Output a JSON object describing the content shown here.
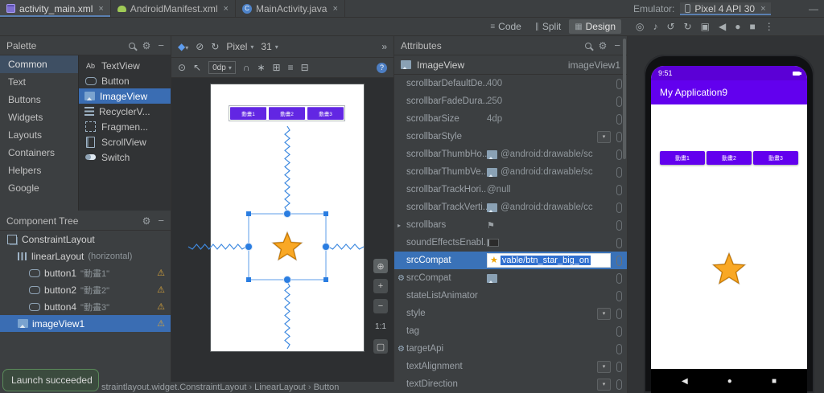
{
  "window": {
    "editor_tabs": [
      {
        "label": "activity_main.xml",
        "icon": "layout-file-icon",
        "active": true
      },
      {
        "label": "AndroidManifest.xml",
        "icon": "android-manifest-icon",
        "active": false
      },
      {
        "label": "MainActivity.java",
        "icon": "java-class-icon",
        "active": false
      }
    ],
    "view_modes": [
      {
        "label": "Code",
        "icon": "code-mode-icon",
        "active": false
      },
      {
        "label": "Split",
        "icon": "split-mode-icon",
        "active": false
      },
      {
        "label": "Design",
        "icon": "design-mode-icon",
        "active": true
      }
    ]
  },
  "palette": {
    "title": "Palette",
    "categories": [
      {
        "label": "Common",
        "selected": true
      },
      {
        "label": "Text",
        "selected": false
      },
      {
        "label": "Buttons",
        "selected": false
      },
      {
        "label": "Widgets",
        "selected": false
      },
      {
        "label": "Layouts",
        "selected": false
      },
      {
        "label": "Containers",
        "selected": false
      },
      {
        "label": "Helpers",
        "selected": false
      },
      {
        "label": "Google",
        "selected": false
      }
    ],
    "components": [
      {
        "label": "TextView",
        "icon": "textview-icon",
        "selected": false
      },
      {
        "label": "Button",
        "icon": "button-icon",
        "selected": false
      },
      {
        "label": "ImageView",
        "icon": "imageview-icon",
        "selected": true
      },
      {
        "label": "RecyclerV...",
        "icon": "recyclerview-icon",
        "selected": false
      },
      {
        "label": "Fragmen...",
        "icon": "fragment-icon",
        "selected": false
      },
      {
        "label": "ScrollView",
        "icon": "scrollview-icon",
        "selected": false
      },
      {
        "label": "Switch",
        "icon": "switch-icon",
        "selected": false
      }
    ]
  },
  "component_tree": {
    "title": "Component Tree",
    "items": [
      {
        "label": "ConstraintLayout",
        "suffix": "",
        "depth": 0,
        "icon": "constraintlayout-icon",
        "warning": false,
        "selected": false
      },
      {
        "label": "linearLayout",
        "suffix": "(horizontal)",
        "depth": 1,
        "icon": "linearlayout-icon",
        "warning": false,
        "selected": false
      },
      {
        "label": "button1",
        "suffix": "\"動畫1\"",
        "depth": 2,
        "icon": "button-icon",
        "warning": true,
        "selected": false
      },
      {
        "label": "button2",
        "suffix": "\"動畫2\"",
        "depth": 2,
        "icon": "button-icon",
        "warning": true,
        "selected": false
      },
      {
        "label": "button4",
        "suffix": "\"動畫3\"",
        "depth": 2,
        "icon": "button-icon",
        "warning": true,
        "selected": false
      },
      {
        "label": "imageView1",
        "suffix": "",
        "depth": 1,
        "icon": "imageview-icon",
        "warning": true,
        "selected": true
      }
    ]
  },
  "design_toolbar": {
    "surface_icons": [
      "design-surface-icon",
      "blueprint-icon",
      "orientation-icon"
    ],
    "device": "Pixel",
    "api": "31",
    "margin": "0dp",
    "zoom": "1:1",
    "tool_icons": [
      "eye-icon",
      "cursor-icon",
      "magnet-icon",
      "wand-icon",
      "guideline-icon",
      "align-icon",
      "pack-icon"
    ],
    "controls": [
      "pan-button",
      "zoom-in-button",
      "zoom-out-button",
      "zoom-level",
      "zoom-fit-button"
    ]
  },
  "canvas": {
    "buttons": [
      "動畫1",
      "動畫2",
      "動畫3"
    ]
  },
  "attributes": {
    "title": "Attributes",
    "component_type": "ImageView",
    "component_id": "imageView1",
    "rows": [
      {
        "label": "scrollbarDefaultDe...",
        "value": "400",
        "type": "text",
        "tools": false,
        "expandable": false,
        "selected": false
      },
      {
        "label": "scrollbarFadeDura...",
        "value": "250",
        "type": "text",
        "tools": false,
        "expandable": false,
        "selected": false
      },
      {
        "label": "scrollbarSize",
        "value": "4dp",
        "type": "text",
        "tools": false,
        "expandable": false,
        "selected": false
      },
      {
        "label": "scrollbarStyle",
        "value": "",
        "type": "dropdown",
        "tools": false,
        "expandable": false,
        "selected": false
      },
      {
        "label": "scrollbarThumbHo...",
        "value": "@android:drawable/sc",
        "type": "drawable",
        "tools": false,
        "expandable": false,
        "selected": false
      },
      {
        "label": "scrollbarThumbVe...",
        "value": "@android:drawable/sc",
        "type": "drawable",
        "tools": false,
        "expandable": false,
        "selected": false
      },
      {
        "label": "scrollbarTrackHori...",
        "value": "@null",
        "type": "text",
        "tools": false,
        "expandable": false,
        "selected": false
      },
      {
        "label": "scrollbarTrackVerti...",
        "value": "@android:drawable/cc",
        "type": "drawable",
        "tools": false,
        "expandable": false,
        "selected": false
      },
      {
        "label": "scrollbars",
        "value": "",
        "type": "flag",
        "tools": false,
        "expandable": true,
        "selected": false
      },
      {
        "label": "soundEffectsEnabl...",
        "value": "",
        "type": "toggle",
        "tools": false,
        "expandable": false,
        "selected": false
      },
      {
        "label": "srcCompat",
        "value": "vable/btn_star_big_on",
        "type": "editing",
        "tools": false,
        "expandable": false,
        "selected": true
      },
      {
        "label": "srcCompat",
        "value": "",
        "type": "picker",
        "tools": true,
        "expandable": false,
        "selected": false
      },
      {
        "label": "stateListAnimator",
        "value": "",
        "type": "text",
        "tools": false,
        "expandable": false,
        "selected": false
      },
      {
        "label": "style",
        "value": "",
        "type": "dropdown",
        "tools": false,
        "expandable": false,
        "selected": false
      },
      {
        "label": "tag",
        "value": "",
        "type": "text",
        "tools": false,
        "expandable": false,
        "selected": false
      },
      {
        "label": "targetApi",
        "value": "",
        "type": "text",
        "tools": true,
        "expandable": false,
        "selected": false
      },
      {
        "label": "textAlignment",
        "value": "",
        "type": "dropdown",
        "tools": false,
        "expandable": false,
        "selected": false
      },
      {
        "label": "textDirection",
        "value": "",
        "type": "dropdown",
        "tools": false,
        "expandable": false,
        "selected": false
      }
    ]
  },
  "emulator": {
    "panel_label": "Emulator:",
    "tab": "Pixel 4 API 30",
    "toolbar_icons": [
      "power",
      "volume-up",
      "rotate-left",
      "rotate-right",
      "screenshot",
      "back",
      "home",
      "overview",
      "more"
    ],
    "time": "9:51",
    "app_title": "My Application9",
    "buttons": [
      "動畫1",
      "動畫2",
      "動畫3"
    ]
  },
  "notification": {
    "text": "Launch succeeded"
  },
  "status_bar": {
    "breadcrumbs": [
      "straintlayout.widget.ConstraintLayout",
      "LinearLayout",
      "Button"
    ]
  },
  "colors": {
    "selection_blue": "#3a6db3",
    "primary_purple": "#6200ee",
    "status_purple": "#5b00d6",
    "star_orange": "#f9a825",
    "constraint_blue": "#3f8ae0",
    "warning_yellow": "#d6a33c",
    "launch_green": "#5a8a5a"
  }
}
